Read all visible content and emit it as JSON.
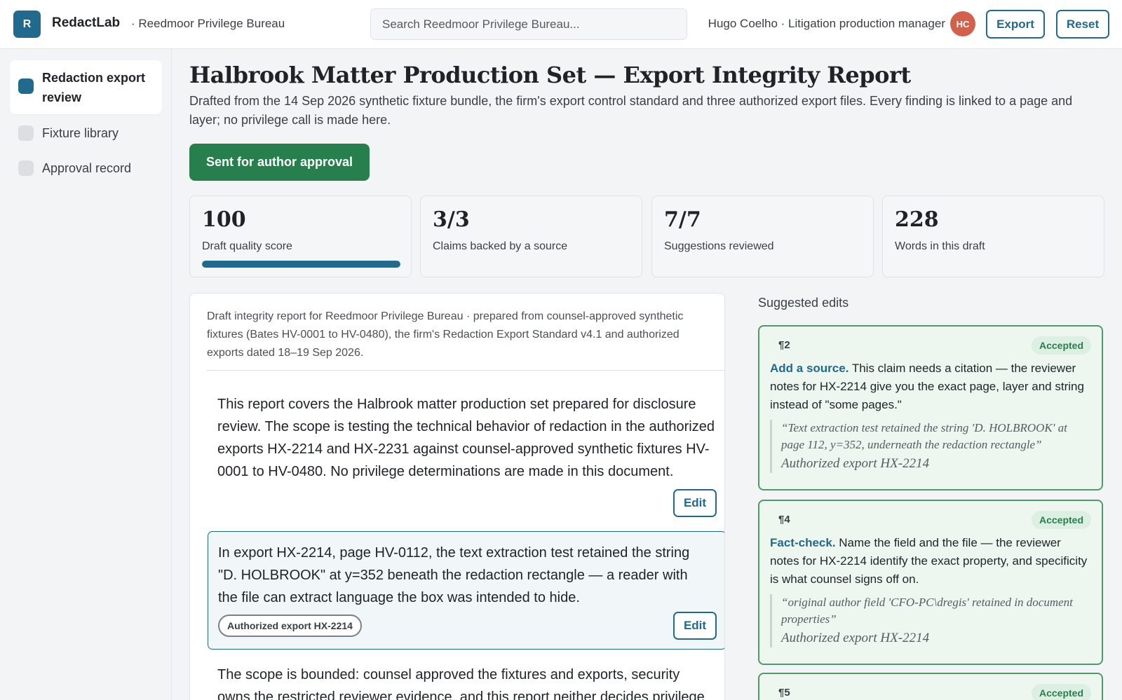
{
  "app": {
    "logo_letter": "R",
    "name": "RedactLab",
    "workspace": "· Reedmoor Privilege Bureau"
  },
  "search": {
    "placeholder": "Search Reedmoor Privilege Bureau..."
  },
  "user": {
    "line": "Hugo Coelho · Litigation production manager",
    "initials": "HC",
    "avatar_color": "#d2604a"
  },
  "toolbar": {
    "export_label": "Export",
    "reset_label": "Reset"
  },
  "sidebar": {
    "items": [
      {
        "label": "Redaction export review",
        "active": true
      },
      {
        "label": "Fixture library",
        "active": false
      },
      {
        "label": "Approval record",
        "active": false
      }
    ]
  },
  "page": {
    "title": "Halbrook Matter Production Set — Export Integrity Report",
    "description": "Drafted from the 14 Sep 2026 synthetic fixture bundle, the firm's export control standard and three authorized export files. Every finding is linked to a page and layer; no privilege call is made here.",
    "status_label": "Sent for author approval"
  },
  "stats": [
    {
      "value": "100",
      "label": "Draft quality score",
      "progress": 1.0
    },
    {
      "value": "3/3",
      "label": "Claims backed by a source"
    },
    {
      "value": "7/7",
      "label": "Suggestions reviewed"
    },
    {
      "value": "228",
      "label": "Words in this draft"
    }
  ],
  "document": {
    "intro": "Draft integrity report for Reedmoor Privilege Bureau · prepared from counsel-approved synthetic fixtures (Bates HV-0001 to HV-0480), the firm's Redaction Export Standard v4.1 and authorized exports dated 18–19 Sep 2026.",
    "paragraphs": [
      {
        "text": "This report covers the Halbrook matter production set prepared for disclosure review. The scope is testing the technical behavior of redaction in the authorized exports HX-2214 and HX-2231 against counsel-approved synthetic fixtures HV-0001 to HV-0480. No privilege determinations are made in this document.",
        "edit_label": "Edit"
      },
      {
        "text": "In export HX-2214, page HV-0112, the text extraction test retained the string \"D. HOLBROOK\" at y=352 beneath the redaction rectangle — a reader with the file can extract language the box was intended to hide.",
        "source": "Authorized export HX-2214",
        "edit_label": "Edit"
      },
      {
        "text": "The scope is bounded: counsel approved the fixtures and exports, security owns the restricted reviewer evidence, and this report neither decides privilege nor"
      }
    ]
  },
  "suggestions": {
    "heading": "Suggested edits",
    "items": [
      {
        "para": "¶2",
        "status": "Accepted",
        "kind": "Add a source.",
        "text": "This claim needs a citation — the reviewer notes for HX-2214 give you the exact page, layer and string instead of \"some pages.\"",
        "quote": "“Text extraction test retained the string 'D. HOLBROOK' at page 112, y=352, underneath the redaction rectangle”",
        "source": "Authorized export HX-2214"
      },
      {
        "para": "¶4",
        "status": "Accepted",
        "kind": "Fact-check.",
        "text": "Name the field and the file — the reviewer notes for HX-2214 identify the exact property, and specificity is what counsel signs off on.",
        "quote": "“original author field 'CFO-PC\\dregis' retained in document properties”",
        "source": "Authorized export HX-2214"
      },
      {
        "para": "¶5",
        "status": "Accepted"
      }
    ]
  },
  "colors": {
    "accent": "#1f6a8d",
    "success": "#277f4e",
    "accepted_border": "#4f9a6b"
  }
}
